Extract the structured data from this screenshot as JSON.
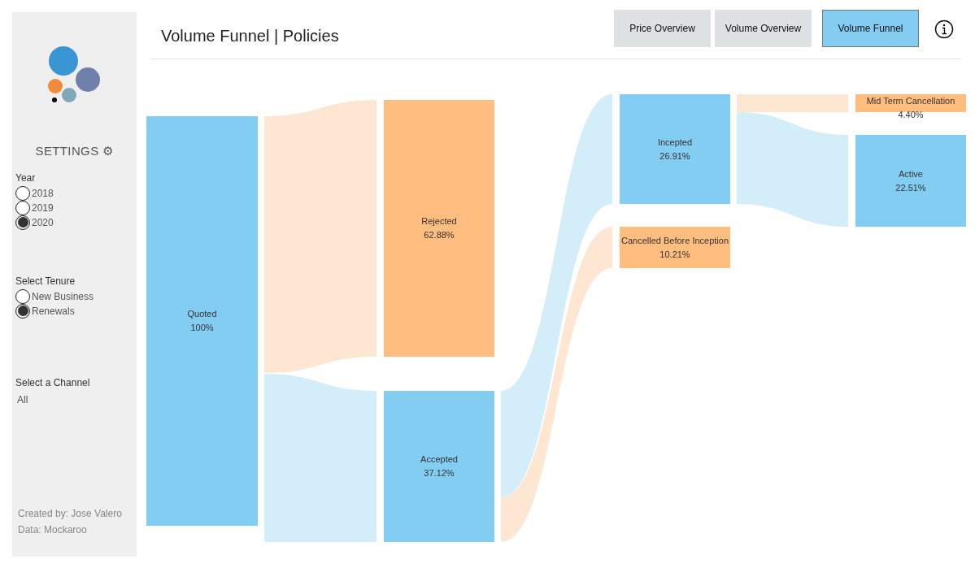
{
  "sidebar": {
    "settings_title": "SETTINGS ⚙",
    "filters": [
      {
        "label": "Year",
        "options": [
          {
            "label": "2018",
            "selected": false
          },
          {
            "label": "2019",
            "selected": false
          },
          {
            "label": "2020",
            "selected": true
          }
        ]
      },
      {
        "label": "Select Tenure",
        "options": [
          {
            "label": "New Business",
            "selected": false
          },
          {
            "label": "Renewals",
            "selected": true
          }
        ]
      }
    ],
    "channel": {
      "label": "Select a Channel",
      "value": "All"
    },
    "credits": [
      "Created by: Jose Valero",
      "Data: Mockaroo"
    ]
  },
  "header": {
    "title": "Volume Funnel | Policies",
    "nav": [
      {
        "label": "Price Overview",
        "selected": false
      },
      {
        "label": "Volume Overview",
        "selected": false
      },
      {
        "label": "Volume Funnel",
        "selected": true
      }
    ]
  },
  "funnel": {
    "nodes": [
      {
        "label": "Quoted",
        "value": "100%",
        "kind": "kept"
      },
      {
        "label": "Rejected",
        "value": "62.88%",
        "kind": "lost"
      },
      {
        "label": "Accepted",
        "value": "37.12%",
        "kind": "kept"
      },
      {
        "label": "Incepted",
        "value": "26.91%",
        "kind": "kept"
      },
      {
        "label": "Cancelled Before Inception",
        "value": "10.21%",
        "kind": "lost"
      },
      {
        "label": "Mid Term Cancellation",
        "value": "4.40%",
        "kind": "lost"
      },
      {
        "label": "Active",
        "value": "22.51%",
        "kind": "kept"
      }
    ]
  }
}
